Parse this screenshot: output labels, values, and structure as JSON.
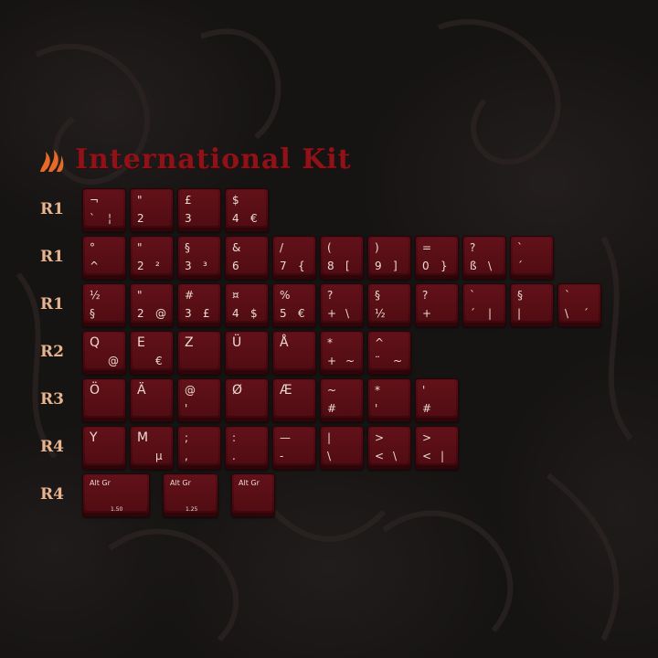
{
  "title": "International Kit",
  "colors": {
    "title": "#8e1218",
    "row_label": "#e7b48e",
    "keycap": "#520c13",
    "legend": "#e9dcd2",
    "logo": "#e86a2a"
  },
  "rows": [
    {
      "label": "R1",
      "keys": [
        {
          "tl": "¬",
          "bl": "`",
          "br": "¦"
        },
        {
          "tl": "\"",
          "bl": "2"
        },
        {
          "tl": "£",
          "bl": "3"
        },
        {
          "tl": "$",
          "bl": "4",
          "br": "€"
        }
      ]
    },
    {
      "label": "R1",
      "keys": [
        {
          "tl": "°",
          "bl": "^"
        },
        {
          "tl": "\"",
          "bl": "2",
          "br": "²"
        },
        {
          "tl": "§",
          "bl": "3",
          "br": "³"
        },
        {
          "tl": "&",
          "bl": "6"
        },
        {
          "tl": "/",
          "bl": "7",
          "br": "{"
        },
        {
          "tl": "(",
          "bl": "8",
          "br": "["
        },
        {
          "tl": ")",
          "bl": "9",
          "br": "]"
        },
        {
          "tl": "=",
          "bl": "0",
          "br": "}"
        },
        {
          "tl": "?",
          "bl": "ß",
          "br": "\\"
        },
        {
          "tl": "`",
          "bl": "´"
        }
      ]
    },
    {
      "label": "R1",
      "keys": [
        {
          "tl": "½",
          "bl": "§"
        },
        {
          "tl": "\"",
          "bl": "2",
          "br": "@"
        },
        {
          "tl": "#",
          "bl": "3",
          "br": "£"
        },
        {
          "tl": "¤",
          "bl": "4",
          "br": "$"
        },
        {
          "tl": "%",
          "bl": "5",
          "br": "€"
        },
        {
          "tl": "?",
          "bl": "+",
          "br": "\\"
        },
        {
          "tl": "§",
          "bl": "½"
        },
        {
          "tl": "?",
          "bl": "+"
        },
        {
          "tl": "`",
          "bl": "´",
          "br": "|"
        },
        {
          "tl": "§",
          "bl": "|"
        },
        {
          "tl": "`",
          "bl": "\\",
          "br": "´"
        }
      ]
    },
    {
      "label": "R2",
      "keys": [
        {
          "tl": "Q",
          "br": "@"
        },
        {
          "tl": "E",
          "br": "€"
        },
        {
          "tl": "Z"
        },
        {
          "tl": "Ü"
        },
        {
          "tl": "Å"
        },
        {
          "tl": "*",
          "bl": "+",
          "br": "~"
        },
        {
          "tl": "^",
          "bl": "¨",
          "br": "~"
        }
      ]
    },
    {
      "label": "R3",
      "keys": [
        {
          "tl": "Ö"
        },
        {
          "tl": "Ä"
        },
        {
          "tl": "@",
          "bl": "'"
        },
        {
          "tl": "Ø"
        },
        {
          "tl": "Æ"
        },
        {
          "tl": "~",
          "bl": "#"
        },
        {
          "tl": "*",
          "bl": "'"
        },
        {
          "tl": "'",
          "bl": "#"
        }
      ]
    },
    {
      "label": "R4",
      "keys": [
        {
          "tl": "Y"
        },
        {
          "tl": "M",
          "br": "µ"
        },
        {
          "tl": ";",
          "bl": ","
        },
        {
          "tl": ":",
          "bl": "."
        },
        {
          "tl": "—",
          "bl": "-"
        },
        {
          "tl": "|",
          "bl": "\\"
        },
        {
          "tl": ">",
          "bl": "<",
          "br": "\\"
        },
        {
          "tl": ">",
          "bl": "<",
          "br": "|"
        }
      ]
    },
    {
      "label": "R4",
      "keys": [
        {
          "tl": "Alt Gr",
          "size": "1.50",
          "w": 1.5
        },
        {
          "tl": "Alt Gr",
          "size": "1.25",
          "w": 1.25
        },
        {
          "tl": "Alt Gr",
          "w": 1
        }
      ]
    }
  ]
}
